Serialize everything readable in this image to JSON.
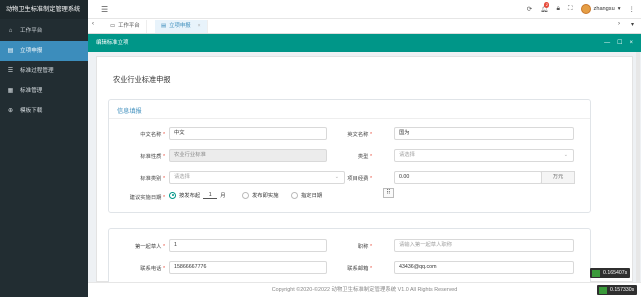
{
  "app": {
    "title": "动物卫生标准制定管理系统"
  },
  "sidebar": {
    "items": [
      {
        "label": "工作平台",
        "icon": "home-icon"
      },
      {
        "label": "立项申报",
        "icon": "document-icon"
      },
      {
        "label": "标准过程管理",
        "icon": "list-icon"
      },
      {
        "label": "标准管理",
        "icon": "table-icon"
      },
      {
        "label": "模板下载",
        "icon": "download-icon"
      }
    ]
  },
  "topbar": {
    "notification_count": "2",
    "username": "zhangsu"
  },
  "tabs": [
    {
      "label": "工作平台"
    },
    {
      "label": "立项申报"
    }
  ],
  "dialog": {
    "title": "编辑标准立项"
  },
  "form": {
    "heading": "农业行业标准申报",
    "section_title": "信息填报",
    "cn_name_label": "中文名称",
    "cn_name_value": "中文",
    "en_name_label": "英文名称",
    "en_name_value": "国为",
    "nature_label": "标准性质",
    "nature_value": "农业行业标准",
    "type_label": "类型",
    "type_placeholder": "请选择",
    "category_label": "标准类别",
    "category_placeholder": "请选择",
    "budget_label": "项目经费",
    "budget_value": "0.00",
    "budget_unit": "万元",
    "date_label": "建议实施日期",
    "radio1_prefix": "按发布起",
    "radio1_months": "1",
    "radio1_suffix": "月",
    "radio2_label": "发布即实施",
    "radio3_label": "指定日期",
    "drafter_label": "第一起草人",
    "drafter_value": "1",
    "title_label": "职称",
    "title_placeholder": "请输入第一起草人职称",
    "phone_label": "联系电话",
    "phone_value": "15866667776",
    "email_label": "联系邮箱",
    "email_value": "43436@qq.com"
  },
  "footer": {
    "copyright": "Copyright ©2020-©2022 动物卫生标准制定管理系统 V1.0 All Rights Reserved"
  },
  "fps": [
    "0.165407s",
    "0.157330s"
  ]
}
